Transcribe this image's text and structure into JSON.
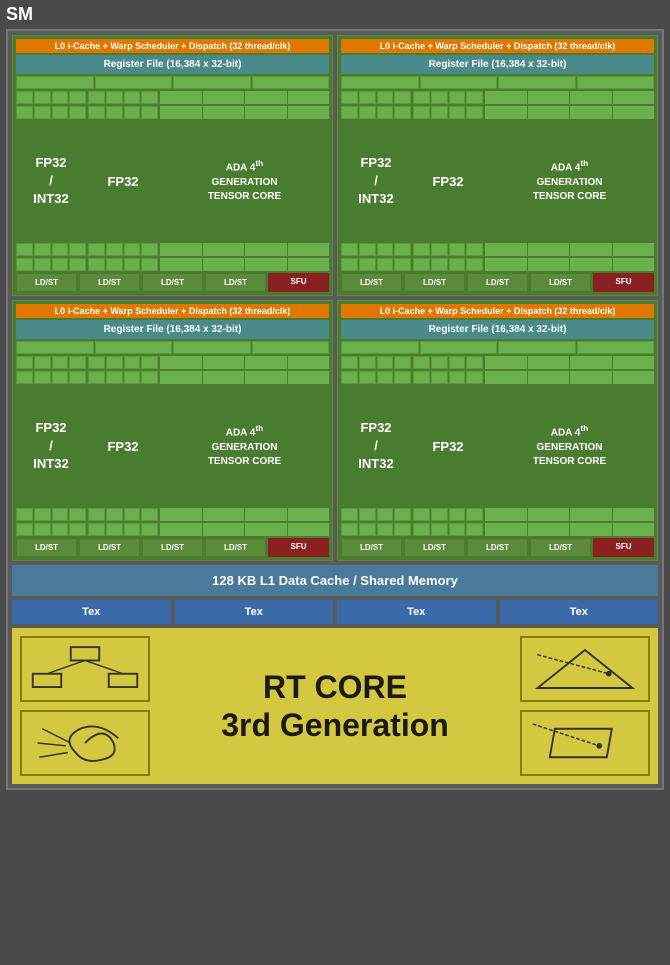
{
  "sm_label": "SM",
  "l0_header": "L0 i-Cache + Warp Scheduler + Dispatch (32 thread/clk)",
  "register_file": "Register File (16,384 x 32-bit)",
  "fp32_int32_label": "FP32\n/\nINT32",
  "fp32_label": "FP32",
  "ada_label_line1": "ADA 4th",
  "ada_label_line2": "GENERATION",
  "ada_label_line3": "TENSOR CORE",
  "ldst_label": "LD/ST",
  "sfu_label": "SFU",
  "l1_cache_label": "128 KB L1 Data Cache / Shared Memory",
  "tex_label": "Tex",
  "rt_core_line1": "RT CORE",
  "rt_core_line2": "3rd Generation",
  "colors": {
    "orange": "#e07800",
    "teal": "#4a8a8a",
    "green_dark": "#4a7c2f",
    "green_medium": "#5a8a3a",
    "green_light": "#6ab04c",
    "red_sfu": "#8a2020",
    "blue_tex": "#3a6aaa",
    "blue_l1": "#4a7a9a",
    "yellow_rt": "#d4c840"
  }
}
